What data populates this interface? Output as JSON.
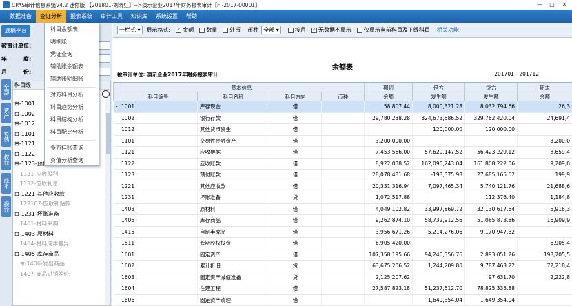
{
  "window": {
    "title": "CPAS审计信息系统V4.2 迷你版 【201801-刘晓红】-->演示企业2017年财务报表审计【FI-2017-00001】",
    "min": "—",
    "max": "□",
    "close": "✕"
  },
  "menu": [
    {
      "label": "数据准备"
    },
    {
      "label": "查证分析"
    },
    {
      "label": "报表系统"
    },
    {
      "label": "审计工具"
    },
    {
      "label": "知识库"
    },
    {
      "label": "系统设置"
    },
    {
      "label": "帮助"
    }
  ],
  "dropdown": [
    "科目余额表",
    "明细账",
    "凭证查询",
    "辅助账余额表",
    "辅助账明细账",
    "对方科目分析",
    "科目趋势分析",
    "科目结构分析",
    "科目配比分析",
    "多方挂账查询",
    "负值分析查询"
  ],
  "left": {
    "tab": "底稿平台",
    "auditee_label": "被审计单位:",
    "year_label": "年",
    "year_label2": "度:",
    "month_label": "月",
    "month_label2": "份:",
    "tree_header": "科目级",
    "vtabs": [
      "全部",
      "资产",
      "负债",
      "权益",
      "成本",
      "损益"
    ],
    "tree": [
      {
        "label": "⊞-1001",
        "sub": false
      },
      {
        "label": "⊞-1002",
        "sub": false
      },
      {
        "label": "⊞-1012",
        "sub": false
      },
      {
        "label": "⊞-1101",
        "sub": false
      },
      {
        "label": "⊞-1121",
        "sub": false
      },
      {
        "label": "⊞-1122",
        "sub": false
      },
      {
        "label": "⊞-1123-预付账款",
        "sub": false
      },
      {
        "label": "1131-应收股利",
        "sub": true
      },
      {
        "label": "1132-应收利息",
        "sub": true
      },
      {
        "label": "⊞-1221-其他应收款",
        "sub": false
      },
      {
        "label": "122107-应收补贴款",
        "sub": true
      },
      {
        "label": "⊞-1231-坏账准备",
        "sub": false
      },
      {
        "label": "1401-材料采购",
        "sub": true
      },
      {
        "label": "⊞-1403-原材料",
        "sub": false
      },
      {
        "label": "1404-材料成本差异",
        "sub": true
      },
      {
        "label": "⊞-1405-库存商品",
        "sub": false
      },
      {
        "label": "⊞-1406-发出商品",
        "sub": true
      },
      {
        "label": "1407-商品进销差价",
        "sub": true
      }
    ]
  },
  "toolbar": {
    "layout": "一栏式",
    "fmt_label": "显示格式:",
    "amount": "金额",
    "qty": "数量",
    "foreign": "外币",
    "currency_label": "币种",
    "currency": "全部",
    "by_month": "按月",
    "hide_zero": "无数据不显示",
    "show_current": "仅显示当前科目及下级科目",
    "related": "相关功能"
  },
  "report": {
    "title": "余额表",
    "auditee": "被审计单位:  演示企业2017年财务报表审计",
    "period": "201701 - 201712"
  },
  "table": {
    "group_headers": [
      "基本信息",
      "期初",
      "借方",
      "贷方",
      "期末"
    ],
    "columns": [
      "科目编号",
      "科目名称",
      "科目方向",
      "币种",
      "余额",
      "发生额",
      "发生额",
      "余额"
    ],
    "rows": [
      [
        "1001",
        "库存现金",
        "借",
        "",
        "58,807.44",
        "8,000,321.28",
        "8,032,794.66",
        "26,3"
      ],
      [
        "1002",
        "银行存款",
        "借",
        "",
        "29,780,238.28",
        "324,673,586.52",
        "329,762,420.04",
        "24,691,4"
      ],
      [
        "1012",
        "其他货币资金",
        "借",
        "",
        "",
        "120,000.00",
        "120,000.00",
        ""
      ],
      [
        "1101",
        "交易性金融资产",
        "借",
        "",
        "3,200,000.00",
        "",
        "",
        "3,200,0"
      ],
      [
        "1121",
        "应收票据",
        "借",
        "",
        "7,453,566.00",
        "57,629,147.52",
        "56,423,229.12",
        "8,659,4"
      ],
      [
        "1122",
        "应收账款",
        "借",
        "",
        "8,922,038.52",
        "162,095,243.04",
        "161,808,222.06",
        "9,209,0"
      ],
      [
        "1123",
        "预付账款",
        "借",
        "",
        "28,078,481.68",
        "-193,375.98",
        "27,685,165.62",
        "199,9"
      ],
      [
        "1221",
        "其他应收款",
        "借",
        "",
        "20,331,316.94",
        "7,097,465.34",
        "5,740,121.76",
        "21,688,6"
      ],
      [
        "1231",
        "坏账准备",
        "贷",
        "",
        "1,072,517.88",
        "",
        "112,376.40",
        "1,184,8"
      ],
      [
        "1403",
        "原材料",
        "借",
        "",
        "4,049,102.82",
        "33,997,869.72",
        "32,130,617.64",
        "5,916,3"
      ],
      [
        "1405",
        "库存商品",
        "借",
        "",
        "9,262,874.10",
        "58,732,912.56",
        "51,085,873.86",
        "16,909,9"
      ],
      [
        "1415",
        "自制半成品",
        "借",
        "",
        "3,956,671.26",
        "5,214,276.06",
        "9,170,947.32",
        ""
      ],
      [
        "1511",
        "长期股权投资",
        "借",
        "",
        "6,905,420.00",
        "",
        "",
        "6,905,4"
      ],
      [
        "1601",
        "固定资产",
        "借",
        "",
        "107,358,195.66",
        "94,240,356.76",
        "2,893,051.26",
        "198,705,5"
      ],
      [
        "1602",
        "累计折旧",
        "贷",
        "",
        "63,675,206.52",
        "1,244,209.80",
        "9,787,463.22",
        "72,218,4"
      ],
      [
        "1603",
        "固定资产减值准备",
        "贷",
        "",
        "2,125,207.62",
        "",
        "97,631.70",
        "2,222,8"
      ],
      [
        "1604",
        "在建工程",
        "借",
        "",
        "27,587,823.18",
        "51,237,512.70",
        "78,825,335.88",
        ""
      ],
      [
        "1606",
        "固定资产清理",
        "借",
        "",
        "",
        "1,649,354.04",
        "1,649,354.04",
        ""
      ]
    ]
  }
}
